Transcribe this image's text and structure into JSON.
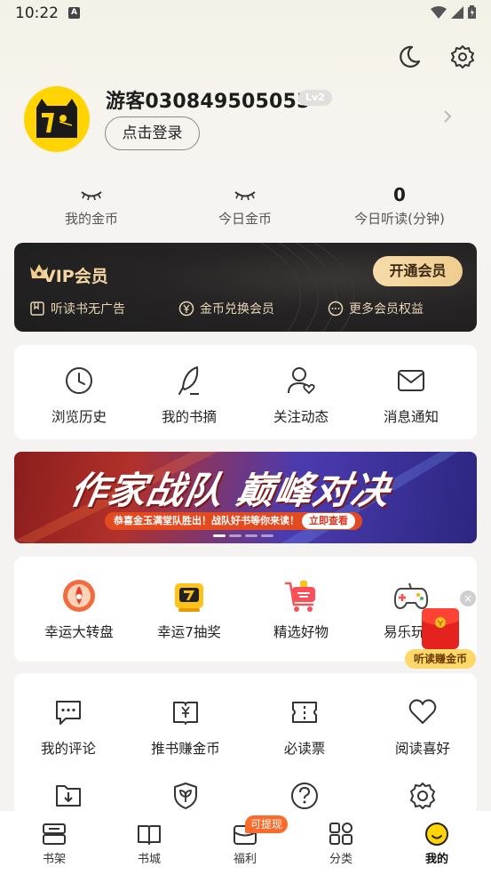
{
  "status_bar": {
    "time": "10:22",
    "notif_letter": "A"
  },
  "profile": {
    "username": "游客030849505055",
    "level": "Lv2",
    "login_button": "点击登录"
  },
  "stats": [
    {
      "value": "",
      "label": "我的金币",
      "hidden": true
    },
    {
      "value": "",
      "label": "今日金币",
      "hidden": true
    },
    {
      "value": "0",
      "label": "今日听读(分钟)",
      "hidden": false
    }
  ],
  "vip": {
    "title": "VIP会员",
    "button": "开通会员",
    "perks": [
      "听读书无广告",
      "金币兑换会员",
      "更多会员权益"
    ]
  },
  "quick_actions": [
    {
      "label": "浏览历史",
      "icon": "clock-icon"
    },
    {
      "label": "我的书摘",
      "icon": "quill-icon"
    },
    {
      "label": "关注动态",
      "icon": "user-heart-icon"
    },
    {
      "label": "消息通知",
      "icon": "mail-icon"
    }
  ],
  "banner": {
    "title": "作家战队 巅峰对决",
    "subtitle": "恭喜金玉满堂队胜出！战队好书等你来读！",
    "cta": "立即查看"
  },
  "activities": [
    {
      "label": "幸运大转盘",
      "icon": "spin-wheel-icon"
    },
    {
      "label": "幸运7抽奖",
      "icon": "lucky7-icon"
    },
    {
      "label": "精选好物",
      "icon": "shopping-cart-icon"
    },
    {
      "label": "易乐玩游",
      "icon": "gamepad-icon"
    }
  ],
  "floating": {
    "label": "听读赚金币",
    "close": "×"
  },
  "tools_row1": [
    {
      "label": "我的评论",
      "icon": "comment-icon"
    },
    {
      "label": "推书赚金币",
      "icon": "book-yen-icon"
    },
    {
      "label": "必读票",
      "icon": "ticket-icon"
    },
    {
      "label": "阅读喜好",
      "icon": "heart-icon"
    }
  ],
  "tools_row2": [
    {
      "label": "",
      "icon": "download-icon"
    },
    {
      "label": "",
      "icon": "leaf-shield-icon"
    },
    {
      "label": "",
      "icon": "help-icon"
    },
    {
      "label": "",
      "icon": "gear-icon"
    }
  ],
  "nav": {
    "items": [
      {
        "label": "书架",
        "icon": "bookshelf-icon"
      },
      {
        "label": "书城",
        "icon": "open-book-icon"
      },
      {
        "label": "福利",
        "icon": "gift-box-icon"
      },
      {
        "label": "分类",
        "icon": "grid-icon"
      },
      {
        "label": "我的",
        "icon": "smile-icon"
      }
    ],
    "badge": "可提现",
    "active_index": 4
  },
  "colors": {
    "accent_gold": "#f0cc8e",
    "vip_bg": "#262424",
    "avatar_yellow": "#ffd400",
    "badge_orange": "#ff6a2a"
  }
}
